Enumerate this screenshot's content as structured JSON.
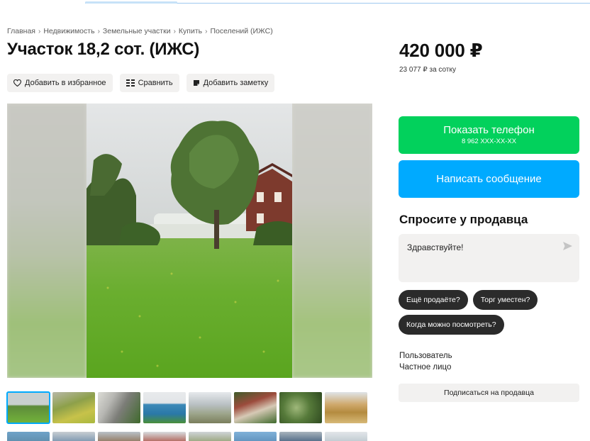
{
  "breadcrumb": [
    "Главная",
    "Недвижимость",
    "Земельные участки",
    "Купить",
    "Поселений (ИЖС)"
  ],
  "title": "Участок 18,2 сот. (ИЖС)",
  "actions": {
    "favorite": "Добавить в избранное",
    "compare": "Сравнить",
    "note": "Добавить заметку"
  },
  "price": {
    "value": "420 000 ₽",
    "per_unit": "23 077 ₽ за сотку"
  },
  "contact": {
    "show_phone_label": "Показать телефон",
    "phone_masked": "8 962 XXX-XX-XX",
    "message_label": "Написать сообщение"
  },
  "ask": {
    "title": "Спросите у продавца",
    "message_value": "Здравствуйте!",
    "chips": [
      "Ещё продаёте?",
      "Торг уместен?",
      "Когда можно посмотреть?"
    ]
  },
  "seller": {
    "name": "Пользователь",
    "type": "Частное лицо",
    "subscribe_label": "Подписаться на продавца"
  },
  "colors": {
    "green": "#02d15c",
    "blue": "#00aaff",
    "chip": "#2b2b2b",
    "light_button": "#f2f1f0"
  },
  "icons": [
    "heart-icon",
    "compare-icon",
    "note-icon",
    "send-icon",
    "chevron-right-icon"
  ]
}
